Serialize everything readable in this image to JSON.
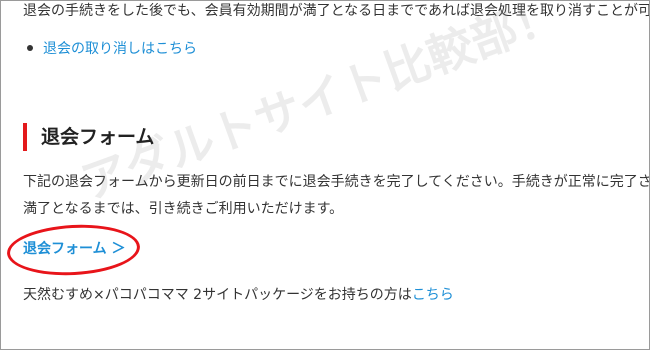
{
  "intro_text": "退会の手続きをした後でも、会員有効期間が満了となる日までであれば退会処理を取り消すことが可",
  "bullet_link": "退会の取り消しはこちら",
  "section_heading": "退会フォーム",
  "body_line1": "下記の退会フォームから更新日の前日までに退会手続きを完了してください。手続きが正常に完了さ",
  "body_line2": "満了となるまでは、引き続きご利用いただけます。",
  "form_link": "退会フォーム ＞",
  "package_text": "天然むすめ×パコパコママ 2サイトパッケージをお持ちの方は",
  "package_link": "こちら",
  "watermark": "アダルトサイト比較部！",
  "colors": {
    "link": "#1e8fd6",
    "accent_red": "#e3191b",
    "circle_red": "#e8141a"
  }
}
